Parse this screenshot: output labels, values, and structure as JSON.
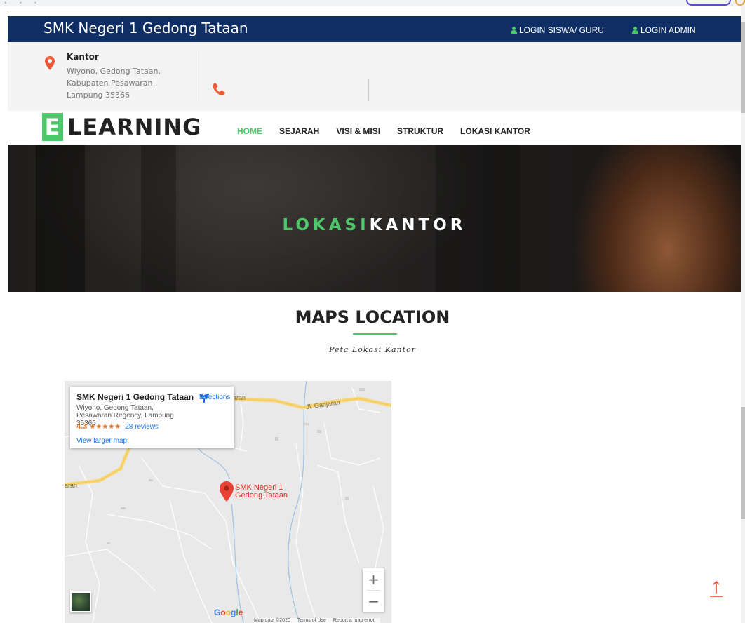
{
  "topbar": {
    "brand": "SMK Negeri 1 Gedong Tataan",
    "login_siswa": "LOGIN SISWA/ GURU",
    "login_admin": "LOGIN ADMIN",
    "color": "#0f2e63"
  },
  "info": {
    "kantor_title": "Kantor",
    "kantor_address": "Wiyono, Gedong Tataan, Kabupaten Pesawaran , Lampung 35366"
  },
  "logo": {
    "letter": "E",
    "word": "LEARNING",
    "accent": "#4cc76a"
  },
  "nav": {
    "items": [
      {
        "label": "HOME",
        "active": true
      },
      {
        "label": "SEJARAH",
        "active": false
      },
      {
        "label": "VISI & MISI",
        "active": false
      },
      {
        "label": "STRUKTUR",
        "active": false
      },
      {
        "label": "LOKASI KANTOR",
        "active": false
      }
    ]
  },
  "hero": {
    "title_green": "LOKASI",
    "title_white": "KANTOR"
  },
  "section": {
    "title": "MAPS LOCATION",
    "subtitle": "Peta Lokasi Kantor"
  },
  "map": {
    "place_name": "SMK Negeri 1 Gedong Tataan",
    "place_address": "Wiyono, Gedong Tataan, Pesawaran Regency, Lampung 35366",
    "rating": "4.3",
    "stars": "★★★★★",
    "reviews": "28 reviews",
    "directions": "Directions",
    "view_larger": "View larger map",
    "marker_label_1": "SMK Negeri 1",
    "marker_label_2": "Gedong Tataan",
    "road_label_1": "anjaran",
    "road_label_2": "Jl. Ganjaran",
    "road_label_3": "aran",
    "zoom_in": "+",
    "zoom_out": "−",
    "google": [
      "G",
      "o",
      "o",
      "g",
      "l",
      "e"
    ],
    "attribution": [
      "Map data ©2020",
      "Terms of Use",
      "Report a map error"
    ]
  }
}
